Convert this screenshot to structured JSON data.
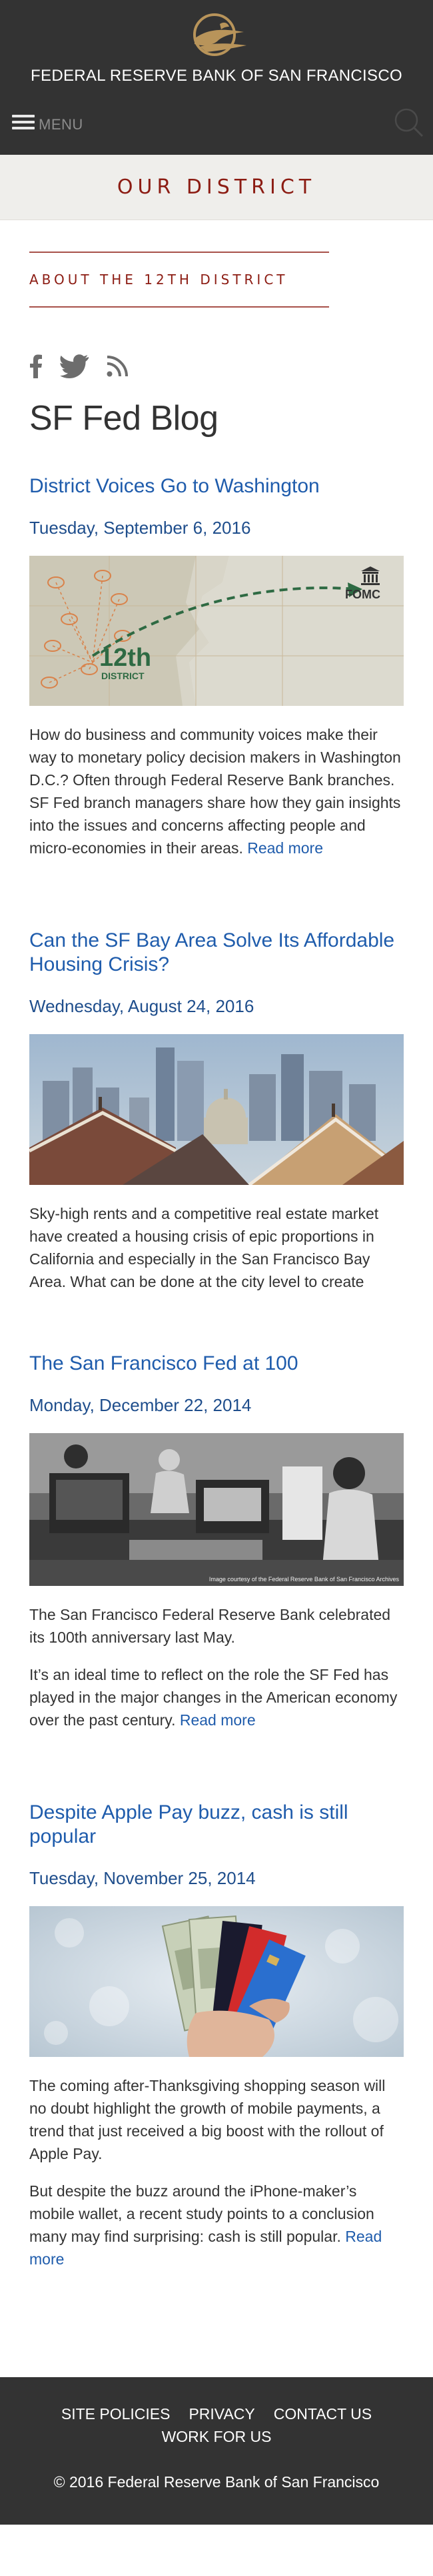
{
  "header": {
    "site_name": "FEDERAL RESERVE BANK OF SAN FRANCISCO",
    "menu_label": "MENU",
    "logo_icon": "eagle-logo-icon",
    "search_icon": "search-icon"
  },
  "section": {
    "title": "OUR DISTRICT",
    "sub_nav_label": "ABOUT THE 12TH DISTRICT"
  },
  "social": [
    {
      "name": "facebook-icon"
    },
    {
      "name": "twitter-icon"
    },
    {
      "name": "rss-icon"
    }
  ],
  "blog": {
    "title": "SF Fed Blog",
    "posts": [
      {
        "title": "District Voices Go to Washington",
        "date": "Tuesday, September 6, 2016",
        "image_labels": {
          "district_number": "12th",
          "district_word": "DISTRICT",
          "destination": "FOMC"
        },
        "paragraphs": [
          "How do business and community voices make their way to monetary policy decision makers in Washington D.C.? Often through Federal Reserve Bank branches. SF Fed branch managers share how they gain insights into the issues and concerns affecting people and micro-economies in their areas."
        ],
        "read_more": "Read more"
      },
      {
        "title": "Can the SF Bay Area Solve Its Affordable Housing Crisis?",
        "date": "Wednesday, August 24, 2016",
        "paragraphs": [
          "Sky-high rents and a competitive real estate market have created a housing crisis of epic proportions in California and especially in the San Francisco Bay Area. What can be done at the city level to create"
        ]
      },
      {
        "title": "The San Francisco Fed at 100",
        "date": "Monday, December 22, 2014",
        "image_caption": "Image courtesy of the Federal Reserve Bank of San Francisco Archives",
        "paragraphs": [
          "The San Francisco Federal Reserve Bank celebrated its 100th anniversary last May.",
          "It’s an ideal time to reflect on the role the SF Fed has played in the major changes in the American economy over the past century."
        ],
        "read_more": "Read more"
      },
      {
        "title": "Despite Apple Pay buzz, cash is still popular",
        "date": "Tuesday, November 25, 2014",
        "paragraphs": [
          "The coming after-Thanksgiving shopping season will no doubt highlight the growth of mobile payments, a trend that just received a big boost with the rollout of Apple Pay.",
          "But despite the buzz around the iPhone-maker’s mobile wallet, a recent study points to a conclusion many may find surprising: cash is still popular."
        ],
        "read_more": "Read more"
      }
    ]
  },
  "footer": {
    "links": [
      "SITE POLICIES",
      "PRIVACY",
      "CONTACT US",
      "WORK FOR US"
    ],
    "copyright": "© 2016 Federal Reserve Bank of San Francisco"
  },
  "colors": {
    "header_bg": "#333333",
    "accent_red": "#8c1c13",
    "link_blue": "#1f5cac",
    "date_blue": "#1f4e8c",
    "banner_bg": "#efeeeb"
  }
}
